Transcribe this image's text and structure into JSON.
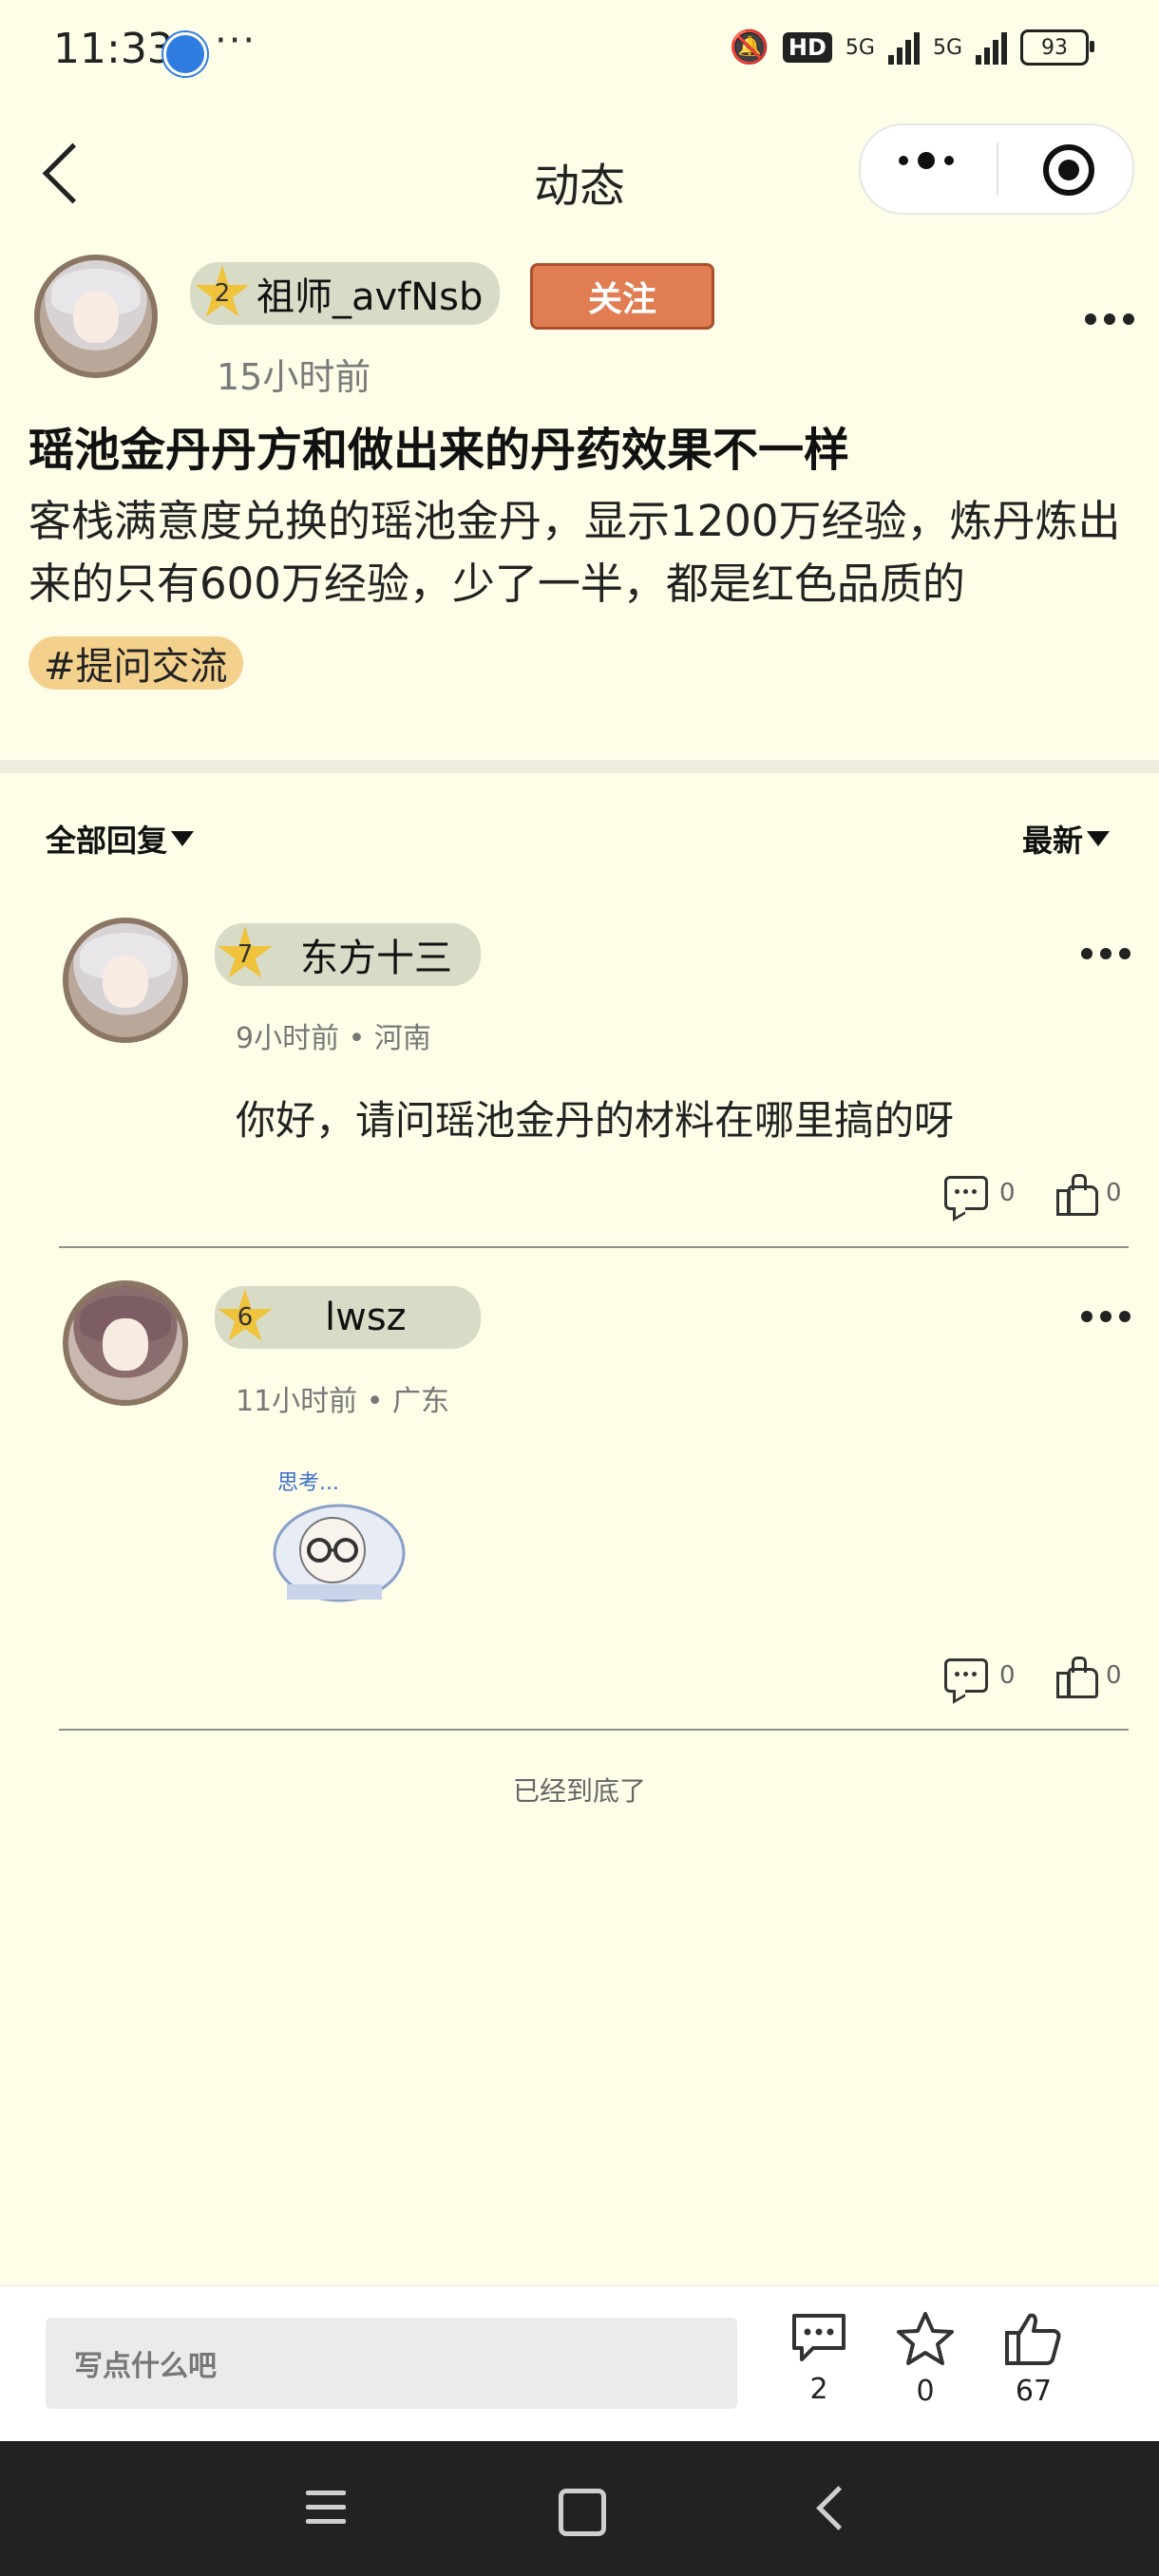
{
  "status_bar": {
    "time": "11:33",
    "dots": "···",
    "hd": "HD",
    "net1": "5G",
    "net2": "5G",
    "battery": "93"
  },
  "header": {
    "title": "动态"
  },
  "post": {
    "author": {
      "level": "2",
      "name": "祖师_avfNsb"
    },
    "follow_label": "关注",
    "time": "15小时前",
    "title": "瑶池金丹丹方和做出来的丹药效果不一样",
    "body": "客栈满意度兑换的瑶池金丹，显示1200万经验，炼丹炼出来的只有600万经验，少了一半，都是红色品质的",
    "tag": "#提问交流"
  },
  "filters": {
    "all_replies": "全部回复",
    "sort": "最新"
  },
  "comments": [
    {
      "level": "7",
      "name": "东方十三",
      "meta": "9小时前 • 河南",
      "text": "你好，请问瑶池金丹的材料在哪里搞的呀",
      "reply_count": "0",
      "like_count": "0"
    },
    {
      "level": "6",
      "name": "lwsz",
      "meta": "11小时前 • 广东",
      "sticker_text": "思考...",
      "reply_count": "0",
      "like_count": "0"
    }
  ],
  "end_text": "已经到底了",
  "bottom_bar": {
    "input_placeholder": "写点什么吧",
    "comments": "2",
    "favorites": "0",
    "likes": "67"
  },
  "colors": {
    "background": "#fefde8",
    "follow": "#e07d52",
    "tag": "#f3d08c",
    "star": "#f0c33c",
    "pill": "#d8dbc6"
  }
}
